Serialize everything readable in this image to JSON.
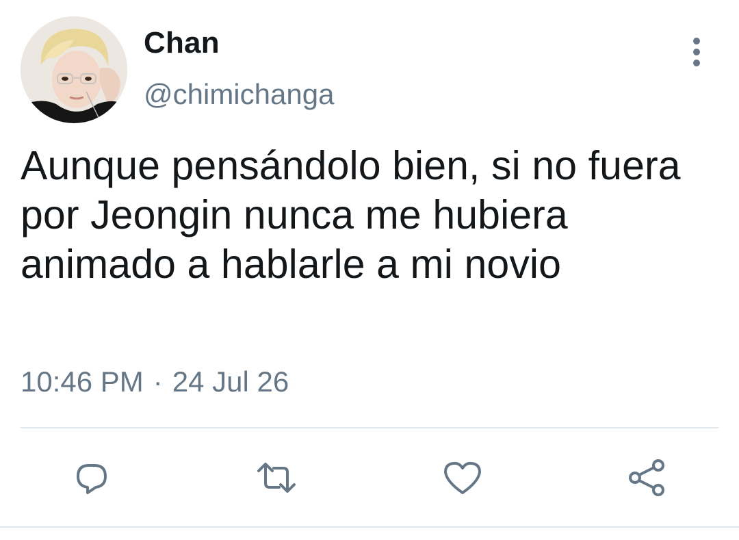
{
  "tweet": {
    "display_name": "Chan",
    "handle": "@chimichanga",
    "text": "Aunque pensándolo bien, si no fuera por Jeongin nunca me hubiera animado a hablarle a mi novio",
    "time": "10:46 PM",
    "separator": "·",
    "date": "24 Jul 26"
  },
  "icons": {
    "avatar": "profile-photo",
    "more": "more-vertical-icon",
    "reply": "reply-icon",
    "retweet": "retweet-icon",
    "like": "heart-icon",
    "share": "share-icon"
  },
  "colors": {
    "text": "#14171a",
    "secondary": "#657786",
    "divider": "#e1e8ed",
    "background": "#ffffff"
  }
}
